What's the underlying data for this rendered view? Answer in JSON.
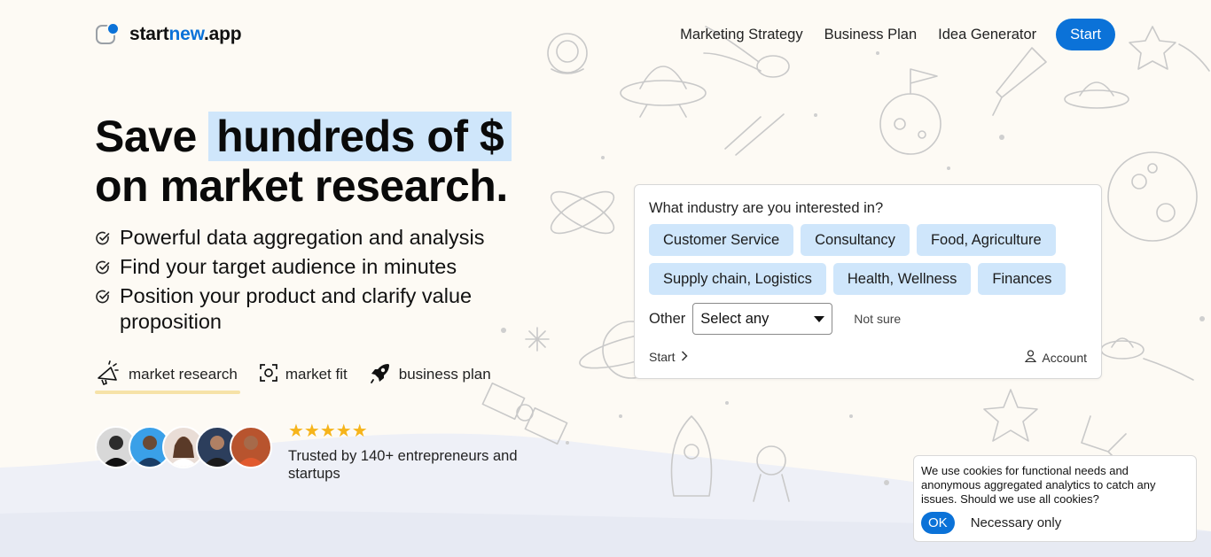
{
  "header": {
    "logo": {
      "start": "start",
      "accent": "new",
      "end": ".app"
    },
    "nav": [
      "Marketing Strategy",
      "Business Plan",
      "Idea Generator"
    ],
    "cta": "Start"
  },
  "hero": {
    "headline_pre": "Save ",
    "headline_highlight": "hundreds of $",
    "headline_line2": "on market research.",
    "features": [
      "Powerful data aggregation and analysis",
      "Find your target audience in minutes",
      "Position your product and clarify value proposition"
    ],
    "tabs": [
      "market research",
      "market fit",
      "business plan"
    ],
    "active_tab": "market research",
    "rating_stars": 5,
    "trusted_text": "Trusted by 140+ entrepreneurs and startups"
  },
  "card": {
    "question": "What industry are you interested in?",
    "chips": [
      "Customer Service",
      "Consultancy",
      "Food, Agriculture",
      "Supply chain, Logistics",
      "Health, Wellness",
      "Finances"
    ],
    "other_label": "Other",
    "select_value": "Select any",
    "not_sure": "Not sure",
    "start": "Start",
    "account": "Account"
  },
  "cookie": {
    "text": "We use cookies for functional needs and anonymous aggregated analytics to catch any issues. Should we use all cookies?",
    "ok": "OK",
    "necessary": "Necessary only"
  },
  "colors": {
    "accent": "#0b72d8",
    "highlight": "#cfe6fb",
    "star": "#f6b41a",
    "tab_underline": "#f6e2a8"
  }
}
